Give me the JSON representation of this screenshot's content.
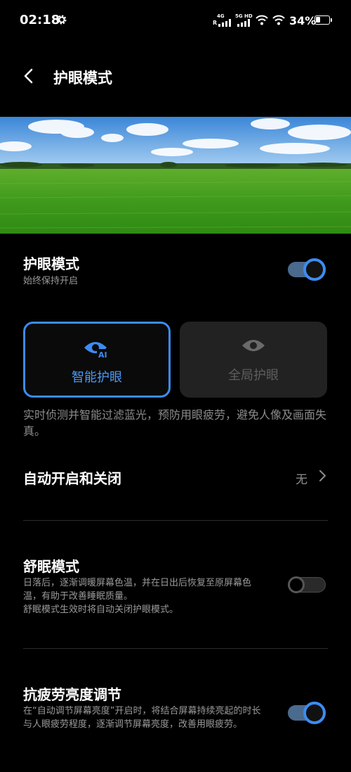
{
  "status": {
    "time": "02:18",
    "sim1_type": "4G",
    "sim1_label": "R",
    "sim2_type": "5G HD",
    "battery": "34%",
    "battery_level": 0.34
  },
  "header": {
    "title": "护眼模式"
  },
  "eye_mode": {
    "title": "护眼模式",
    "subtitle": "始终保持开启",
    "enabled": true
  },
  "modes": [
    {
      "label": "智能护眼",
      "badge": "AI",
      "selected": true
    },
    {
      "label": "全局护眼",
      "selected": false
    }
  ],
  "mode_description": "实时侦测并智能过滤蓝光，预防用眼疲劳，避免人像及画面失真。",
  "schedule": {
    "title": "自动开启和关闭",
    "value": "无"
  },
  "sleep_mode": {
    "title": "舒眠模式",
    "description": "日落后，逐渐调暖屏幕色温，并在日出后恢复至原屏幕色温，有助于改善睡眠质量。\n舒眠模式生效时将自动关闭护眼模式。",
    "enabled": false
  },
  "anti_fatigue": {
    "title": "抗疲劳亮度调节",
    "description": "在“自动调节屏幕亮度”开启时，将结合屏幕持续亮起的时长与人眼疲劳程度，逐渐调节屏幕亮度，改善用眼疲劳。",
    "enabled": true
  },
  "colors": {
    "accent": "#3d8bf0",
    "background": "#000000",
    "secondary_text": "#8c8c8c"
  },
  "icons": [
    "settings-gear-icon",
    "cellular-signal-icon",
    "wifi-icon",
    "battery-icon",
    "back-arrow-icon",
    "eye-ai-icon",
    "eye-icon",
    "chevron-right-icon"
  ]
}
